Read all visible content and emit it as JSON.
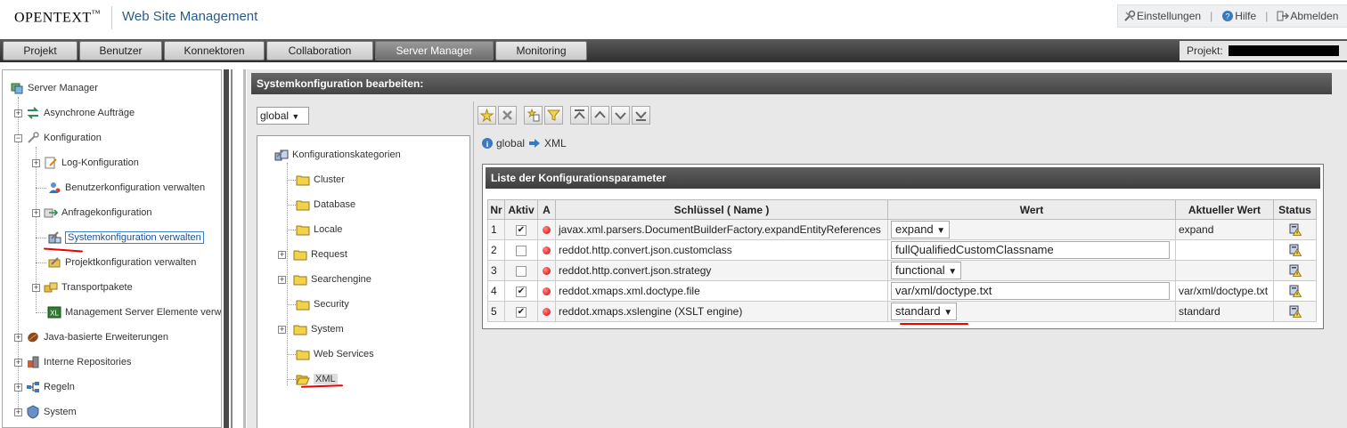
{
  "header": {
    "brand": "OpenText",
    "brand_tm": "™",
    "product": "Web Site Management",
    "links": [
      {
        "label": "Einstellungen",
        "icon": "tools-icon"
      },
      {
        "label": "Hilfe",
        "icon": "help-icon"
      },
      {
        "label": "Abmelden",
        "icon": "logout-icon"
      }
    ],
    "separator": "|"
  },
  "tabs": [
    {
      "label": "Projekt",
      "active": false
    },
    {
      "label": "Benutzer",
      "active": false
    },
    {
      "label": "Konnektoren",
      "active": false
    },
    {
      "label": "Collaboration",
      "active": false
    },
    {
      "label": "Server Manager",
      "active": true
    },
    {
      "label": "Monitoring",
      "active": false
    }
  ],
  "project_label": "Projekt:",
  "tree": {
    "root": "Server Manager",
    "items": [
      {
        "label": "Asynchrone Aufträge",
        "expand": "+"
      },
      {
        "label": "Konfiguration",
        "expand": "−"
      },
      {
        "label": "Log-Konfiguration",
        "expand": "+"
      },
      {
        "label": "Benutzerkonfiguration verwalten",
        "expand": ""
      },
      {
        "label": "Anfragekonfiguration",
        "expand": "+"
      },
      {
        "label": "Systemkonfiguration verwalten",
        "expand": "",
        "selected": true
      },
      {
        "label": "Projektkonfiguration verwalten",
        "expand": ""
      },
      {
        "label": "Transportpakete",
        "expand": "+"
      },
      {
        "label": "Management Server Elemente verwa",
        "expand": ""
      },
      {
        "label": "Java-basierte Erweiterungen",
        "expand": "+"
      },
      {
        "label": "Interne Repositories",
        "expand": "+"
      },
      {
        "label": "Regeln",
        "expand": "+"
      },
      {
        "label": "System",
        "expand": "+"
      }
    ]
  },
  "content": {
    "title": "Systemkonfiguration bearbeiten:",
    "scope_value": "global",
    "categories": {
      "root": "Konfigurationskategorien",
      "items": [
        {
          "label": "Cluster",
          "expand": ""
        },
        {
          "label": "Database",
          "expand": ""
        },
        {
          "label": "Locale",
          "expand": ""
        },
        {
          "label": "Request",
          "expand": "+"
        },
        {
          "label": "Searchengine",
          "expand": "+"
        },
        {
          "label": "Security",
          "expand": ""
        },
        {
          "label": "System",
          "expand": "+"
        },
        {
          "label": "Web Services",
          "expand": ""
        },
        {
          "label": "XML",
          "expand": "",
          "selected": true
        }
      ]
    },
    "toolbar": [
      "new-star-icon",
      "delete-icon",
      "edit-star-icon",
      "filter-icon",
      "move-top-icon",
      "move-up-icon",
      "move-down-icon",
      "move-bottom-icon"
    ],
    "breadcrumb": {
      "scope": "global",
      "category": "XML"
    },
    "params": {
      "title": "Liste der Konfigurationsparameter",
      "headers": {
        "nr": "Nr",
        "aktiv": "Aktiv",
        "a": "A",
        "key": "Schlüssel ( Name )",
        "wert": "Wert",
        "aktuell": "Aktueller Wert",
        "status": "Status"
      },
      "rows": [
        {
          "nr": "1",
          "aktiv": true,
          "key": "javax.xml.parsers.DocumentBuilderFactory.expandEntityReferences",
          "wert": "expand",
          "wert_type": "select",
          "aktuell": "expand"
        },
        {
          "nr": "2",
          "aktiv": false,
          "key": "reddot.http.convert.json.customclass",
          "wert": "fullQualifiedCustomClassname",
          "wert_type": "input",
          "aktuell": ""
        },
        {
          "nr": "3",
          "aktiv": false,
          "key": "reddot.http.convert.json.strategy",
          "wert": "functional",
          "wert_type": "select",
          "aktuell": ""
        },
        {
          "nr": "4",
          "aktiv": true,
          "key": "reddot.xmaps.xml.doctype.file",
          "wert": "var/xml/doctype.txt",
          "wert_type": "input",
          "aktuell": "var/xml/doctype.txt"
        },
        {
          "nr": "5",
          "aktiv": true,
          "key": "reddot.xmaps.xslengine (XSLT engine)",
          "wert": "standard",
          "wert_type": "select",
          "aktuell": "standard"
        }
      ]
    }
  },
  "glyphs": {
    "dropdown": "▼",
    "check": "✔"
  }
}
